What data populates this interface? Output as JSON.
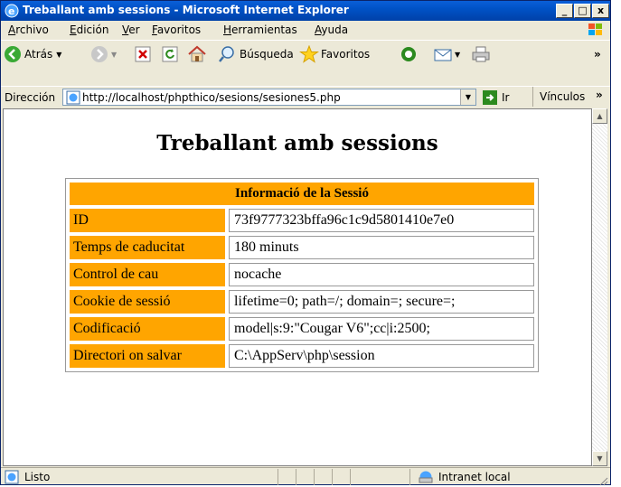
{
  "window": {
    "title": "Treballant amb sessions - Microsoft Internet Explorer",
    "min_label": "_",
    "max_label": "□",
    "close_label": "x"
  },
  "menu": [
    "Archivo",
    "Edición",
    "Ver",
    "Favoritos",
    "Herramientas",
    "Ayuda"
  ],
  "toolbar": {
    "back_label": "Atrás",
    "search_label": "Búsqueda",
    "favorites_label": "Favoritos",
    "overflow": "»"
  },
  "address": {
    "label": "Dirección",
    "url": "http://localhost/phpthico/sesions/sesiones5.php",
    "go_label": "Ir",
    "links_label": "Vínculos"
  },
  "page": {
    "title": "Treballant amb sessions",
    "table_header": "Informació de la Sessió",
    "rows": [
      {
        "key": "ID",
        "value": "73f9777323bffa96c1c9d5801410e7e0"
      },
      {
        "key": "Temps de caducitat",
        "value": "180 minuts"
      },
      {
        "key": "Control de cau",
        "value": "nocache"
      },
      {
        "key": "Cookie de sessió",
        "value": "lifetime=0; path=/; domain=; secure=;"
      },
      {
        "key": "Codificació",
        "value": "model|s:9:\"Cougar V6\";cc|i:2500;"
      },
      {
        "key": "Directori on salvar",
        "value": "C:\\AppServ\\php\\session"
      }
    ]
  },
  "status": {
    "text": "Listo",
    "zone": "Intranet local"
  },
  "colors": {
    "titlebar": "#0052c6",
    "table_accent": "#ffa500"
  }
}
